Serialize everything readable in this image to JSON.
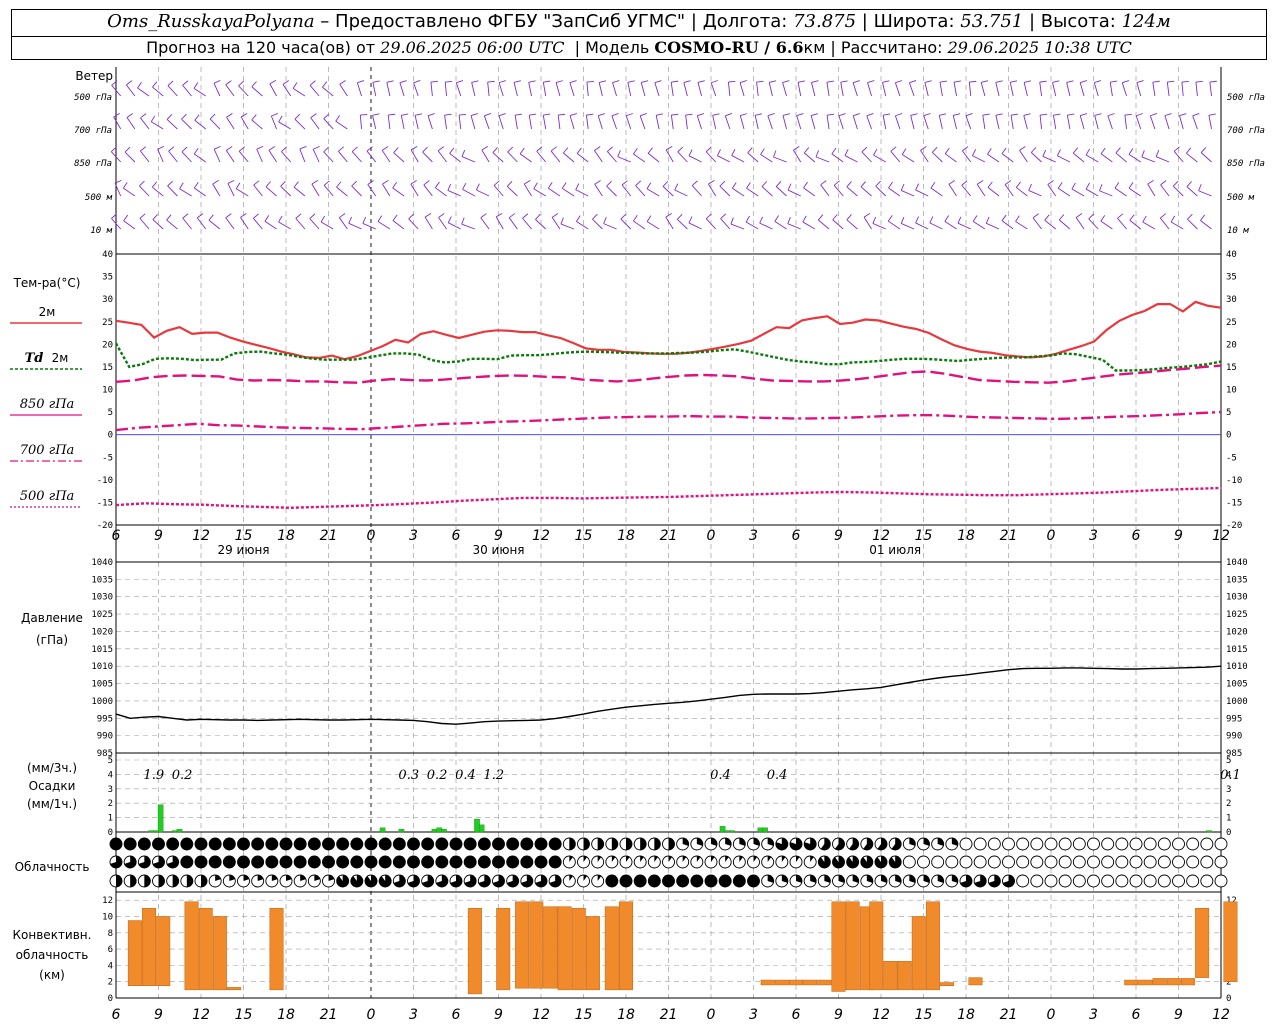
{
  "header": {
    "station": "Oms_RusskayaPolyana",
    "dash": " – ",
    "provider": "Предоставлено ФГБУ \"ЗапСиб УГМС\"",
    "lon_label": "Долгота:",
    "lon": "73.875",
    "lat_label": "Широта:",
    "lat": "53.751",
    "alt_label": "Высота:",
    "alt": "124м",
    "forecast_prefix": "Прогноз на 120 часа(ов) от",
    "run_time": "29.06.2025 06:00 UTC",
    "model_prefix": "Модель",
    "model": "COSMO-RU / 6.6",
    "model_unit": "км",
    "calc_label": "Рассчитано:",
    "calc_time": "29.06.2025 10:38 UTC"
  },
  "panel_labels": {
    "wind": "Ветер",
    "wind_levels": [
      "500 гПа",
      "700 гПа",
      "850 гПа",
      "500 м",
      "10 м"
    ],
    "temp": "Тем-ра(°C)",
    "t2m": "2м",
    "td": "Td",
    "td2m": "2м",
    "t850": "850 гПа",
    "t700": "700 гПа",
    "t500": "500 гПа",
    "pressure": "Давление",
    "pressure_unit": "(гПа)",
    "precip_unit3": "(мм/3ч.)",
    "precip": "Осадки",
    "precip_unit1": "(мм/1ч.)",
    "cloud": "Облачность",
    "conv1": "Конвективн.",
    "conv2": "облачность",
    "conv3": "(км)"
  },
  "colors": {
    "t2m": "#e8383d",
    "td2m": "#0a7a0a",
    "t850": "#e0117f",
    "t700": "#e0117f",
    "t500": "#e0117f",
    "zero_line": "#3030ff",
    "wind": "#7d2cd0",
    "pressure": "#000000",
    "precip": "#22cc22",
    "conv": "#f08a2a",
    "grid": "#a0a0a0"
  },
  "chart_data": [
    {
      "type": "line",
      "title": "Тем-ра(°C)",
      "x_hours": [
        0,
        3,
        6,
        9,
        12,
        15,
        18,
        21,
        24,
        27,
        30,
        33,
        36,
        39,
        42,
        45,
        48,
        51,
        54,
        57,
        60,
        63,
        66,
        69,
        72,
        75,
        78,
        81,
        84,
        87,
        90,
        93,
        96,
        99,
        102,
        105,
        108,
        111,
        114,
        117,
        120,
        123,
        126,
        129,
        132,
        135,
        138,
        141,
        144,
        147,
        150,
        153,
        156,
        159,
        162,
        165,
        168,
        171,
        174,
        177,
        180,
        183,
        186,
        189,
        192,
        195,
        198,
        201,
        204,
        207,
        210,
        213,
        216,
        219,
        222,
        225,
        228,
        231,
        234
      ],
      "ylim": [
        -20,
        40
      ],
      "yticks": [
        40,
        35,
        30,
        25,
        20,
        15,
        10,
        5,
        0,
        -5,
        -10,
        -15,
        -20
      ],
      "series": [
        {
          "name": "2м",
          "key": "t2m",
          "values": [
            25.2,
            24.8,
            24.3,
            21.5,
            23.0,
            23.8,
            22.3,
            22.6,
            22.6,
            21.5,
            20.6,
            19.9,
            19.2,
            18.4,
            17.8,
            17.1,
            17.0,
            17.5,
            16.7,
            17.4,
            18.5,
            19.6,
            21.0,
            20.4,
            22.3,
            22.9,
            22.1,
            21.4,
            22.1,
            22.8,
            23.1,
            23.0,
            22.7,
            22.7,
            22.0,
            21.4,
            20.3,
            19.1,
            18.8,
            18.8,
            18.3,
            18.2,
            18.0,
            17.9,
            17.9,
            18.1,
            18.5,
            19.0,
            19.5,
            20.1,
            20.8,
            22.3,
            23.8,
            23.6,
            25.3,
            25.8,
            26.2,
            24.5,
            24.8,
            25.5,
            25.3,
            24.6,
            23.9,
            23.4,
            22.5,
            21.1,
            19.8,
            19.0,
            18.4,
            18.1,
            17.6,
            17.3,
            17.1,
            17.3,
            17.9,
            18.8,
            19.6,
            20.6,
            23.2,
            25.2,
            26.5,
            27.4,
            28.9,
            28.9,
            27.3,
            29.4,
            28.5,
            28.1
          ]
        },
        {
          "name": "2м",
          "key": "td2m",
          "values": [
            20.2,
            15.0,
            15.6,
            16.8,
            16.9,
            16.8,
            16.5,
            16.6,
            16.6,
            18.0,
            18.3,
            18.4,
            18.0,
            17.7,
            17.2,
            16.8,
            16.6,
            16.6,
            16.6,
            17.0,
            17.5,
            18.0,
            18.0,
            17.7,
            16.5,
            16.0,
            16.2,
            16.8,
            16.8,
            16.7,
            17.5,
            17.6,
            17.6,
            17.8,
            18.1,
            18.3,
            18.4,
            18.3,
            18.2,
            18.1,
            18.0,
            18.0,
            18.0,
            18.1,
            18.2,
            18.4,
            18.7,
            18.9,
            18.4,
            17.8,
            17.2,
            16.6,
            16.2,
            16.0,
            15.6,
            15.6,
            16.0,
            16.1,
            16.3,
            16.6,
            16.8,
            16.8,
            16.7,
            16.5,
            16.3,
            16.6,
            16.8,
            17.0,
            17.1,
            17.1,
            17.3,
            17.5,
            18.0,
            17.8,
            17.2,
            16.6,
            14.2,
            14.2,
            14.3,
            14.5,
            14.8,
            15.0,
            15.3,
            15.6,
            16.2
          ]
        },
        {
          "name": "850 гПа",
          "key": "t850",
          "values": [
            11.7,
            12.0,
            12.7,
            13.0,
            13.1,
            13.0,
            12.9,
            12.2,
            12.0,
            12.1,
            12.0,
            11.8,
            11.8,
            11.6,
            11.5,
            12.0,
            12.3,
            12.1,
            12.0,
            12.2,
            12.5,
            12.8,
            13.0,
            13.1,
            13.0,
            12.8,
            12.7,
            12.2,
            12.0,
            11.8,
            12.0,
            12.4,
            12.8,
            13.1,
            13.2,
            13.1,
            12.9,
            12.4,
            12.0,
            11.9,
            11.8,
            11.8,
            12.0,
            12.3,
            12.8,
            13.3,
            13.8,
            14.0,
            13.5,
            12.8,
            12.1,
            11.9,
            11.7,
            11.6,
            11.5,
            11.8,
            12.3,
            12.8,
            13.3,
            13.6,
            13.9,
            14.3,
            14.6,
            15.0,
            15.3
          ]
        },
        {
          "name": "700 гПа",
          "key": "t700",
          "values": [
            1.0,
            1.5,
            1.8,
            2.1,
            2.4,
            2.1,
            2.0,
            1.8,
            1.6,
            1.5,
            1.4,
            1.3,
            1.2,
            1.5,
            1.8,
            2.1,
            2.4,
            2.5,
            2.7,
            2.9,
            3.0,
            3.2,
            3.4,
            3.6,
            3.8,
            3.9,
            4.0,
            4.0,
            4.1,
            4.0,
            4.0,
            3.8,
            3.7,
            3.6,
            3.6,
            3.7,
            3.8,
            4.0,
            4.2,
            4.3,
            4.3,
            4.1,
            3.9,
            3.8,
            3.7,
            3.6,
            3.5,
            3.6,
            3.8,
            4.0,
            4.1,
            4.3,
            4.5,
            4.8,
            5.0
          ]
        },
        {
          "name": "500 гПа",
          "key": "t500",
          "values": [
            -15.6,
            -15.2,
            -15.4,
            -15.5,
            -15.8,
            -16.0,
            -16.2,
            -16.0,
            -15.8,
            -15.6,
            -15.3,
            -15.0,
            -14.6,
            -14.3,
            -14.0,
            -14.0,
            -14.1,
            -14.0,
            -13.9,
            -13.8,
            -13.6,
            -13.4,
            -13.2,
            -13.0,
            -12.8,
            -12.7,
            -12.8,
            -13.0,
            -13.2,
            -13.3,
            -13.4,
            -13.4,
            -13.2,
            -13.0,
            -12.8,
            -12.5,
            -12.2,
            -12.0,
            -11.8
          ]
        }
      ],
      "legend": [
        "2м",
        "Td 2м",
        "850 гПа",
        "700 гПа",
        "500 гПа"
      ]
    },
    {
      "type": "line",
      "title": "Давление",
      "ylabel": "(гПа)",
      "ylim": [
        985,
        1040
      ],
      "yticks": [
        1040,
        1035,
        1030,
        1025,
        1020,
        1015,
        1010,
        1005,
        1000,
        995,
        990,
        985
      ],
      "series": [
        {
          "name": "Давление",
          "values": [
            996.2,
            995.0,
            995.3,
            995.5,
            995.0,
            994.5,
            994.7,
            994.6,
            994.5,
            994.5,
            994.4,
            994.5,
            994.6,
            994.7,
            994.6,
            994.5,
            994.5,
            994.6,
            994.7,
            994.6,
            994.5,
            994.4,
            994.0,
            993.5,
            993.3,
            993.6,
            994.0,
            994.2,
            994.3,
            994.4,
            994.5,
            994.9,
            995.5,
            996.2,
            997.0,
            997.6,
            998.2,
            998.6,
            999.0,
            999.3,
            999.6,
            1000.0,
            1000.5,
            1001.0,
            1001.6,
            1001.9,
            1002.0,
            1002.0,
            1002.0,
            1002.1,
            1002.4,
            1002.8,
            1003.2,
            1003.5,
            1003.9,
            1004.6,
            1005.3,
            1006.0,
            1006.6,
            1007.1,
            1007.5,
            1008.0,
            1008.5,
            1009.0,
            1009.3,
            1009.4,
            1009.4,
            1009.5,
            1009.5,
            1009.4,
            1009.3,
            1009.2,
            1009.2,
            1009.3,
            1009.4,
            1009.5,
            1009.6,
            1009.7,
            1010.0
          ]
        }
      ]
    },
    {
      "type": "bar",
      "title": "Осадки",
      "ylim": [
        0,
        5
      ],
      "yticks": [
        5,
        4,
        3,
        2,
        1,
        0
      ],
      "sum3h_labels": [
        {
          "h": 8,
          "text": "1.9"
        },
        {
          "h": 14,
          "text": "0.2"
        },
        {
          "h": 62,
          "text": "0.3"
        },
        {
          "h": 68,
          "text": "0.2"
        },
        {
          "h": 74,
          "text": "0.4"
        },
        {
          "h": 80,
          "text": "1.2"
        },
        {
          "h": 128,
          "text": "0.4"
        },
        {
          "h": 140,
          "text": "0.4"
        },
        {
          "h": 236,
          "text": "0.1"
        }
      ],
      "hourly_values": [
        0,
        0,
        0,
        0,
        0,
        0,
        0,
        0.1,
        0.1,
        1.9,
        0,
        0,
        0.1,
        0.2,
        0,
        0,
        0,
        0,
        0,
        0,
        0,
        0,
        0,
        0,
        0,
        0,
        0,
        0,
        0,
        0,
        0,
        0,
        0,
        0,
        0,
        0,
        0,
        0,
        0,
        0,
        0,
        0,
        0,
        0,
        0,
        0,
        0,
        0,
        0,
        0,
        0,
        0,
        0,
        0,
        0,
        0,
        0.3,
        0,
        0,
        0,
        0.2,
        0,
        0,
        0,
        0,
        0,
        0,
        0.2,
        0.3,
        0.2,
        0,
        0,
        0,
        0,
        0,
        0,
        0.9,
        0.5,
        0,
        0,
        0,
        0,
        0,
        0,
        0,
        0,
        0,
        0,
        0,
        0,
        0,
        0,
        0,
        0,
        0,
        0,
        0,
        0,
        0,
        0,
        0,
        0,
        0,
        0,
        0,
        0,
        0,
        0,
        0,
        0,
        0,
        0,
        0,
        0,
        0,
        0,
        0,
        0,
        0,
        0,
        0,
        0,
        0,
        0,
        0,
        0,
        0,
        0,
        0.4,
        0.1,
        0.1,
        0,
        0,
        0,
        0,
        0,
        0.3,
        0.3,
        0,
        0,
        0,
        0,
        0,
        0,
        0,
        0,
        0,
        0,
        0,
        0,
        0,
        0,
        0,
        0,
        0,
        0,
        0,
        0,
        0,
        0,
        0,
        0,
        0,
        0,
        0,
        0,
        0,
        0,
        0,
        0,
        0,
        0,
        0,
        0,
        0,
        0,
        0,
        0,
        0,
        0,
        0,
        0,
        0,
        0,
        0,
        0,
        0,
        0,
        0,
        0,
        0,
        0,
        0,
        0,
        0,
        0,
        0,
        0,
        0,
        0,
        0,
        0,
        0,
        0,
        0,
        0,
        0,
        0,
        0,
        0,
        0,
        0,
        0,
        0,
        0,
        0,
        0,
        0,
        0,
        0,
        0,
        0,
        0,
        0,
        0,
        0,
        0,
        0,
        0,
        0,
        0,
        0.1,
        0,
        0,
        0,
        0,
        0,
        0,
        0,
        0
      ]
    },
    {
      "type": "bar",
      "title": "Конвективн. облачность",
      "ylabel": "(км)",
      "ylim": [
        0,
        13
      ],
      "yticks": [
        12,
        10,
        8,
        6,
        4,
        2,
        0
      ],
      "bars": [
        {
          "h": 4,
          "base": 1.5,
          "top": 9.5
        },
        {
          "h": 7,
          "base": 1.5,
          "top": 11.0
        },
        {
          "h": 10,
          "base": 1.5,
          "top": 10.0
        },
        {
          "h": 16,
          "base": 1.0,
          "top": 11.8
        },
        {
          "h": 19,
          "base": 1.0,
          "top": 11.0
        },
        {
          "h": 22,
          "base": 1.0,
          "top": 10.0
        },
        {
          "h": 25,
          "base": 1.0,
          "top": 1.3
        },
        {
          "h": 34,
          "base": 1.0,
          "top": 11.0
        },
        {
          "h": 76,
          "base": 0.5,
          "top": 11.0
        },
        {
          "h": 82,
          "base": 1.0,
          "top": 11.0
        },
        {
          "h": 86,
          "base": 1.2,
          "top": 11.8
        },
        {
          "h": 89,
          "base": 1.2,
          "top": 11.8
        },
        {
          "h": 92,
          "base": 1.2,
          "top": 11.2
        },
        {
          "h": 95,
          "base": 1.0,
          "top": 11.2
        },
        {
          "h": 98,
          "base": 1.0,
          "top": 11.0
        },
        {
          "h": 101,
          "base": 1.0,
          "top": 10.0
        },
        {
          "h": 105,
          "base": 1.0,
          "top": 11.2
        },
        {
          "h": 108,
          "base": 1.0,
          "top": 11.8
        },
        {
          "h": 138,
          "base": 1.6,
          "top": 2.2
        },
        {
          "h": 141,
          "base": 1.6,
          "top": 2.2
        },
        {
          "h": 144,
          "base": 1.6,
          "top": 2.2
        },
        {
          "h": 147,
          "base": 1.6,
          "top": 2.2
        },
        {
          "h": 150,
          "base": 1.6,
          "top": 2.2
        },
        {
          "h": 153,
          "base": 0.8,
          "top": 11.8
        },
        {
          "h": 156,
          "base": 1.0,
          "top": 11.8
        },
        {
          "h": 159,
          "base": 1.0,
          "top": 11.2
        },
        {
          "h": 161,
          "base": 1.0,
          "top": 11.8
        },
        {
          "h": 164,
          "base": 1.0,
          "top": 4.5
        },
        {
          "h": 167,
          "base": 1.0,
          "top": 4.5
        },
        {
          "h": 170,
          "base": 1.0,
          "top": 10.0
        },
        {
          "h": 173,
          "base": 1.0,
          "top": 11.8
        },
        {
          "h": 176,
          "base": 1.5,
          "top": 1.9
        },
        {
          "h": 182,
          "base": 1.6,
          "top": 2.5
        },
        {
          "h": 215,
          "base": 1.6,
          "top": 2.2
        },
        {
          "h": 218,
          "base": 1.6,
          "top": 2.2
        },
        {
          "h": 221,
          "base": 1.6,
          "top": 2.4
        },
        {
          "h": 224,
          "base": 1.6,
          "top": 2.4
        },
        {
          "h": 227,
          "base": 1.6,
          "top": 2.4
        },
        {
          "h": 230,
          "base": 2.5,
          "top": 11.0
        },
        {
          "h": 236,
          "base": 2.0,
          "top": 11.8
        }
      ]
    }
  ],
  "time_axis": {
    "hour_labels": [
      "6",
      "9",
      "12",
      "15",
      "18",
      "21",
      "0",
      "3",
      "6",
      "9",
      "12",
      "15",
      "18",
      "21",
      "0",
      "3",
      "6",
      "9",
      "12",
      "15",
      "18",
      "21",
      "0",
      "3",
      "6",
      "9",
      "12"
    ],
    "dates": [
      "29 июня",
      "30 июня",
      "01 июля"
    ]
  }
}
